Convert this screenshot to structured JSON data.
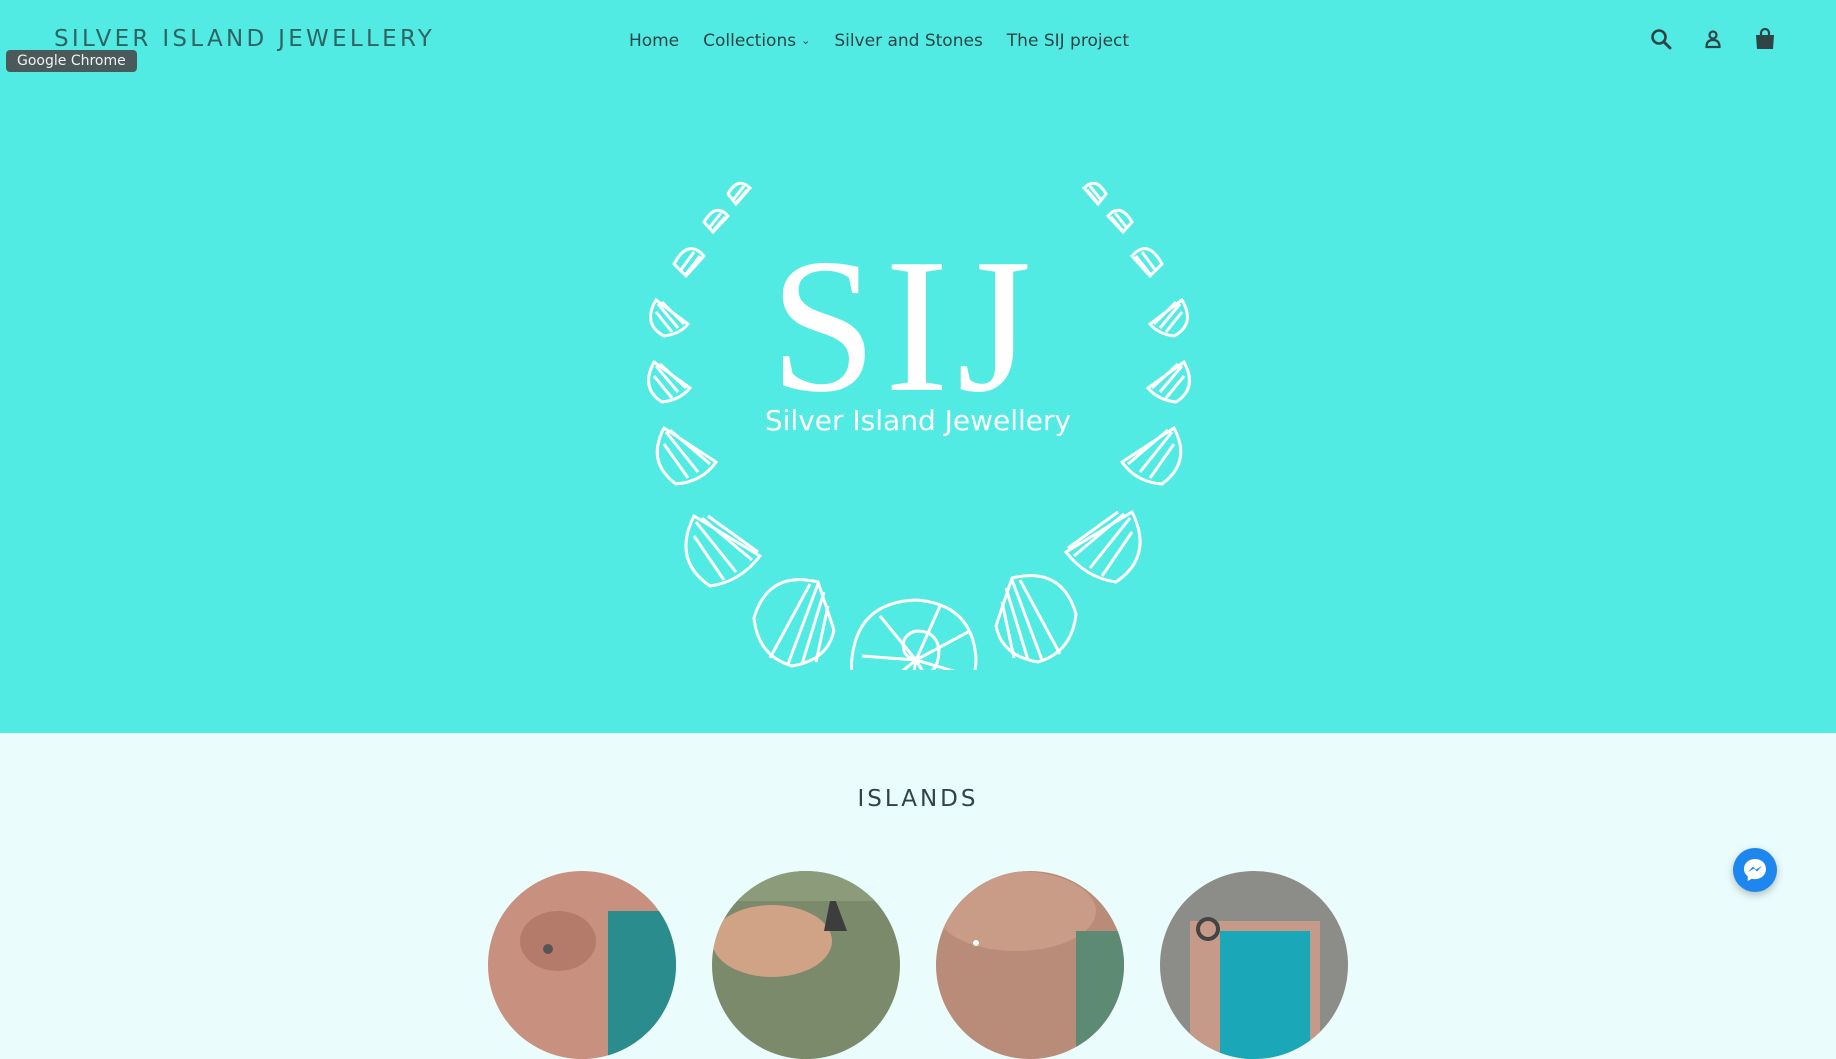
{
  "header": {
    "brand": "SILVER ISLAND JEWELLERY",
    "tooltip": "Google Chrome",
    "bg_color": "#52ebe4"
  },
  "nav": {
    "items": [
      {
        "label": "Home"
      },
      {
        "label": "Collections",
        "has_dropdown": true
      },
      {
        "label": "Silver and Stones"
      },
      {
        "label": "The SIJ project"
      }
    ]
  },
  "header_icons": [
    "search-icon",
    "account-icon",
    "cart-icon"
  ],
  "hero": {
    "logo_letters": "SIJ",
    "logo_tagline": "Silver Island Jewellery"
  },
  "islands_section": {
    "title": "ISLANDS",
    "items": [
      {
        "name": "island-1"
      },
      {
        "name": "island-2"
      },
      {
        "name": "island-3"
      },
      {
        "name": "island-4"
      }
    ]
  },
  "messenger": {
    "icon": "messenger-icon",
    "color": "#1e86ef"
  }
}
